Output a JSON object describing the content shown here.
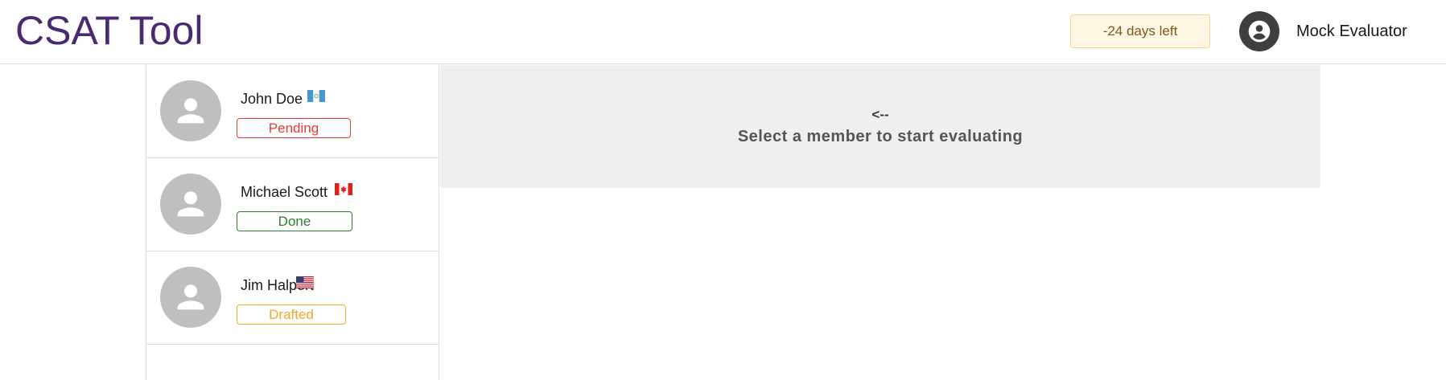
{
  "header": {
    "title": "CSAT Tool",
    "deadline_label": "-24 days left",
    "user_name": "Mock Evaluator",
    "user_icon": "account-circle-icon"
  },
  "members": [
    {
      "name": "John Doe",
      "flag": "guatemala-flag",
      "status": "Pending",
      "status_color": "#e53935"
    },
    {
      "name": "Michael Scott",
      "flag": "canada-flag",
      "status": "Done",
      "status_color": "#2e7d32"
    },
    {
      "name": "Jim Halpert",
      "flag": "usa-flag",
      "status": "Drafted",
      "status_color": "#f5a623"
    }
  ],
  "main": {
    "arrow": "<--",
    "prompt": "Select a member to start evaluating"
  },
  "colors": {
    "brand": "#4b2870",
    "deadline_bg": "#fef6e3",
    "deadline_border": "#f3d38f",
    "panel_bg": "#efefef"
  }
}
